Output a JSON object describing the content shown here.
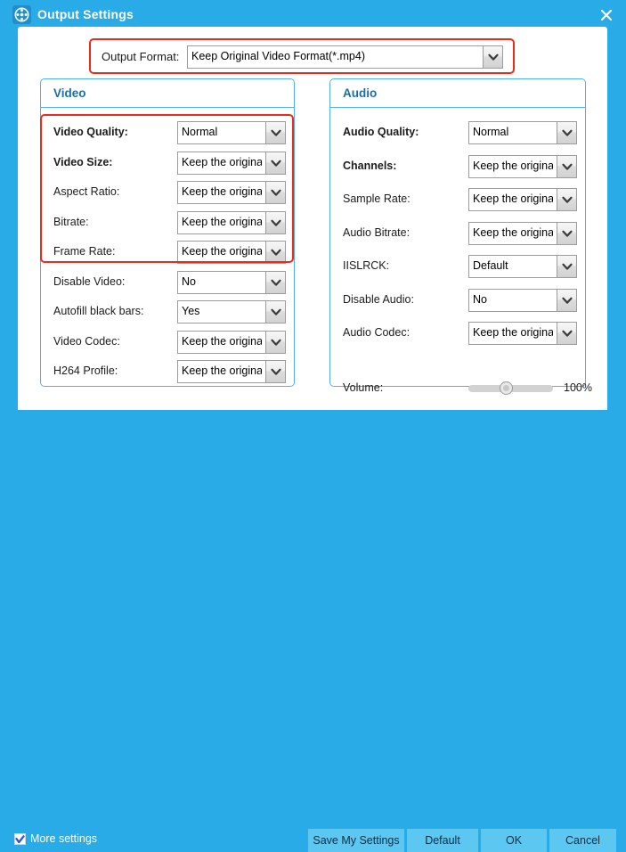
{
  "window": {
    "title": "Output Settings",
    "icon": "film-reel-icon",
    "close_icon": "close-icon",
    "accent_color": "#29ABE8",
    "highlight_color": "#F02A18"
  },
  "output_format": {
    "label": "Output Format:",
    "value": "Keep Original Video Format(*.mp4)"
  },
  "video": {
    "title": "Video",
    "rows": [
      {
        "label": "Video Quality:",
        "value": "Normal",
        "bold": true
      },
      {
        "label": "Video Size:",
        "value": "Keep the original",
        "bold": true
      },
      {
        "label": "Aspect Ratio:",
        "value": "Keep the original",
        "bold": false
      },
      {
        "label": "Bitrate:",
        "value": "Keep the original",
        "bold": false
      },
      {
        "label": "Frame Rate:",
        "value": "Keep the original",
        "bold": false
      },
      {
        "label": "Disable Video:",
        "value": "No",
        "bold": false
      },
      {
        "label": "Autofill black bars:",
        "value": "Yes",
        "bold": false
      },
      {
        "label": "Video Codec:",
        "value": "Keep the original",
        "bold": false
      },
      {
        "label": "H264 Profile:",
        "value": "Keep the original",
        "bold": false
      }
    ]
  },
  "audio": {
    "title": "Audio",
    "rows": [
      {
        "label": "Audio Quality:",
        "value": "Normal",
        "bold": true
      },
      {
        "label": "Channels:",
        "value": "Keep the original",
        "bold": true
      },
      {
        "label": "Sample Rate:",
        "value": "Keep the original",
        "bold": false
      },
      {
        "label": "Audio Bitrate:",
        "value": "Keep the original",
        "bold": false
      },
      {
        "label": "IISLRCK:",
        "value": "Default",
        "bold": false
      },
      {
        "label": "Disable Audio:",
        "value": "No",
        "bold": false
      },
      {
        "label": "Audio Codec:",
        "value": "Keep the original",
        "bold": false
      }
    ],
    "volume": {
      "label": "Volume:",
      "value": "100%",
      "slider_percent": 45
    }
  },
  "footer": {
    "more_settings_label": "More settings",
    "more_settings_checked": true,
    "buttons": [
      {
        "id": "save",
        "label": "Save My Settings"
      },
      {
        "id": "default",
        "label": "Default"
      },
      {
        "id": "ok",
        "label": "OK"
      },
      {
        "id": "cancel",
        "label": "Cancel"
      }
    ]
  }
}
